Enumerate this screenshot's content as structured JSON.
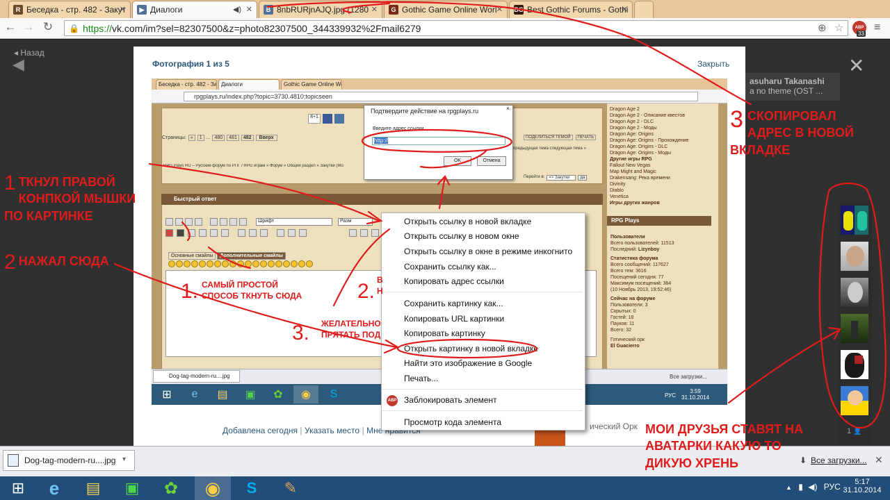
{
  "browser": {
    "tabs": [
      {
        "title": "Беседка - стр. 482 - Закут",
        "icon": "rpgplays-favicon",
        "active": false
      },
      {
        "title": "Диалоги",
        "icon": "vk-favicon",
        "active": true
      },
      {
        "title": "8nbRURjnAJQ.jpg (1280",
        "icon": "vk-favicon",
        "active": false
      },
      {
        "title": "Gothic Game Online Worl",
        "icon": "gothic-favicon",
        "active": false
      },
      {
        "title": "Best Gothic Forums - Gothi",
        "icon": "gothic-favicon",
        "active": false
      }
    ],
    "url_secure": "https://",
    "url_rest": "vk.com/im?sel=82307500&z=photo82307500_344339932%2Fmail6279",
    "abp_badge": "33"
  },
  "vk": {
    "back_label": "Назад",
    "photo_counter": "Фотография 1 из 5",
    "close_label": "Закрыть",
    "peek_name": "asuharu Takanashi",
    "peek_sub": "a no theme (OST ...",
    "footer_added": "Добавлена сегодня",
    "footer_place": "Указать место",
    "footer_like": "Мне нравится",
    "side_text": "ический Орк",
    "avatar_count": "1"
  },
  "screenshot": {
    "tabs": [
      "Беседка - стр. 482 - Закут",
      "Диалоги",
      "Gothic Game Online Worl"
    ],
    "url": "rpgplays.ru/index.php?topic=3730.4810;topicseen",
    "pages_label": "Страницы:",
    "pages": [
      "«",
      "1",
      "...",
      "480",
      "481",
      "482",
      "Вверх"
    ],
    "breadcrumb": "RPG Plays RU – Русский форум по РПГ / RPG играм » Форум » Общий раздел » Закутки (Мо",
    "share_label": "ПОДЕЛИТЬСЯ ТЕМОЙ",
    "print_label": "ПЕЧАТЬ",
    "nav_label": "« предыдущая тема следующая тема »",
    "goto_label": "Перейти в:",
    "goto_value": "=> Закутки",
    "goto_btn": "да",
    "quick_reply": "Быстрый ответ",
    "font_select": "Шрифт",
    "size_select": "Разм",
    "smiles_tab1": "Основные смайлы",
    "smiles_tab2": "Дополнительные смайлы",
    "dialog_title": "Подтвердите действие на rpgplays.ru",
    "dialog_label": "Введите адрес ссылки.",
    "dialog_value": "http://",
    "dialog_ok": "OK",
    "dialog_cancel": "Отмена",
    "right_links": [
      "Dragon Age 2",
      "Dragon Age 2 - Описание квестов",
      "Dragon Age 2 - DLC",
      "Dragon Age 2 - Моды",
      "Dragon Age: Origins",
      "Dragon Age: Origins - Прохождение",
      "Dragon Age: Origins - DLC",
      "Dragon Age: Origins - Моды",
      "Другие игры RPG",
      "Fallout New Vegas",
      "Map Might and Magic",
      "Drakensang: Река времени",
      "Divinity",
      "Diablo",
      "Venetica",
      "Игры других жанров"
    ],
    "rpg_plays_head": "RPG Plays",
    "users_head": "Пользователи",
    "users_total": "Всего пользователей: 11513",
    "users_last_label": "Последний:",
    "users_last": "Lizynboy",
    "stats_head": "Статистика форума",
    "stats": [
      "Всего сообщений: 117627",
      "Всего тем: 3616",
      "Посещений сегодня: 77",
      "Максимум посещений: 364",
      "(10 Ноябрь 2013, 19:52:46)"
    ],
    "online_head": "Сейчас на форуме",
    "online": [
      "Пользователи: 3",
      "Скрытых: 0",
      "Гостей: 18",
      "Пауков: 11",
      "Всего: 32"
    ],
    "online_user": "Готический орк",
    "online_user2": "El Guacierro",
    "download_file": "Dog-tag-modern-ru....jpg",
    "download_all": "Все загрузки...",
    "lang": "РУС",
    "time": "3:59",
    "date": "31.10.2014"
  },
  "context_menu": {
    "items": [
      "Открыть ссылку в новой вкладке",
      "Открыть ссылку в новом окне",
      "Открыть ссылку в окне в режиме инкогнито",
      "Сохранить ссылку как...",
      "Копировать адрес ссылки",
      "Сохранить картинку как...",
      "Копировать URL картинки",
      "Копировать картинку",
      "Открыть картинку в новой вкладке",
      "Найти это изображение в Google",
      "Печать...",
      "Заблокировать элемент",
      "Просмотр кода элемента"
    ],
    "abp_icon_text": "ABP"
  },
  "download_bar": {
    "file": "Dog-tag-modern-ru....jpg",
    "all": "Все загрузки..."
  },
  "taskbar": {
    "lang": "РУС",
    "time": "5:17",
    "date": "31.10.2014"
  },
  "annotations": {
    "step1": "ТКНУЛ ПРАВОЙ КОНПКОЙ МЫШКИ ПО КАРТИНКЕ",
    "step1_num": "1",
    "step2": "НАЖАЛ СЮДА",
    "step2_num": "2",
    "step3": "СКОПИРОВАЛ АДРЕС В НОВОЙ ВКЛАДКЕ",
    "step3_num": "3",
    "friends": "МОИ ДРУЗЬЯ СТАВЯТ НА АВАТАРКИ КАКУЮ ТО ДИКУЮ ХРЕНЬ",
    "inner_simple": "САМЫЙ ПРОСТОЙ СПОСОБ ТКНУТЬ СЮДА",
    "inner_simple_num": "1.",
    "inner_b": "В Н",
    "inner_b_num": "2.",
    "inner_hide": "ЖЕЛАТЕЛЬНО ПРЯТАТЬ ПОД",
    "inner_hide_num": "3."
  },
  "colors": {
    "annotation": "#e01b1b",
    "vk_link": "#2b587a",
    "taskbar": "#214d78"
  }
}
